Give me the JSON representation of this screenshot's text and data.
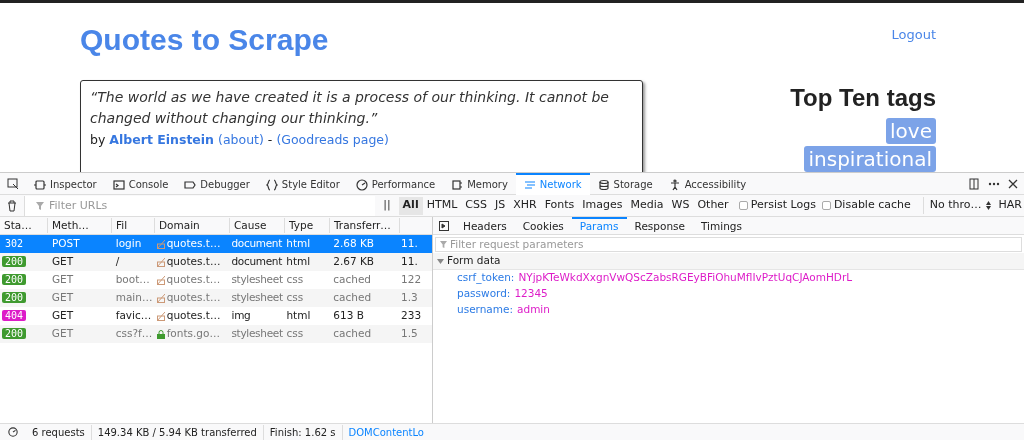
{
  "page": {
    "title": "Quotes to Scrape",
    "logout": "Logout",
    "quote": {
      "text": "“The world as we have created it is a process of our thinking. It cannot be changed without changing our thinking.”",
      "by": "by",
      "author": "Albert Einstein",
      "about": "(about)",
      "dash": "-",
      "goodreads": "(Goodreads page)"
    },
    "tags_heading": "Top Ten tags",
    "tags": [
      "love",
      "inspirational"
    ]
  },
  "devtools": {
    "tabs": [
      {
        "label": "Inspector",
        "selected": false
      },
      {
        "label": "Console",
        "selected": false
      },
      {
        "label": "Debugger",
        "selected": false
      },
      {
        "label": "Style Editor",
        "selected": false
      },
      {
        "label": "Performance",
        "selected": false
      },
      {
        "label": "Memory",
        "selected": false
      },
      {
        "label": "Network",
        "selected": true
      },
      {
        "label": "Storage",
        "selected": false
      },
      {
        "label": "Accessibility",
        "selected": false
      }
    ],
    "filter_placeholder": "Filter URLs",
    "pause": "||",
    "type_filters": [
      {
        "label": "All",
        "selected": true
      },
      {
        "label": "HTML",
        "selected": false
      },
      {
        "label": "CSS",
        "selected": false
      },
      {
        "label": "JS",
        "selected": false
      },
      {
        "label": "XHR",
        "selected": false
      },
      {
        "label": "Fonts",
        "selected": false
      },
      {
        "label": "Images",
        "selected": false
      },
      {
        "label": "Media",
        "selected": false
      },
      {
        "label": "WS",
        "selected": false
      },
      {
        "label": "Other",
        "selected": false
      }
    ],
    "options": [
      {
        "label": "Persist Logs",
        "checked": false
      },
      {
        "label": "Disable cache",
        "checked": false
      }
    ],
    "throttle": "No thro…",
    "har": "HAR",
    "columns": [
      "Sta…",
      "Meth…",
      "Fil",
      "Domain",
      "Cause",
      "Type",
      "Transferr…"
    ],
    "rows": [
      {
        "status": "302",
        "method": "POST",
        "file": "login",
        "domain": "quotes.t…",
        "secure": false,
        "cause": "document",
        "type": "html",
        "transferred": "2.68 KB",
        "size": "11.",
        "dimmed": false,
        "selected": true
      },
      {
        "status": "200",
        "color": "#3f9a2f",
        "method": "GET",
        "file": "/",
        "domain": "quotes.t…",
        "secure": false,
        "cause": "document",
        "type": "html",
        "transferred": "2.67 KB",
        "size": "11.",
        "dimmed": false,
        "selected": false
      },
      {
        "status": "200",
        "color": "#3f9a2f",
        "method": "GET",
        "file": "boot…",
        "domain": "quotes.t…",
        "secure": false,
        "cause": "stylesheet",
        "type": "css",
        "transferred": "cached",
        "size": "122",
        "dimmed": true,
        "selected": false
      },
      {
        "status": "200",
        "color": "#3f9a2f",
        "method": "GET",
        "file": "main…",
        "domain": "quotes.t…",
        "secure": false,
        "cause": "stylesheet",
        "type": "css",
        "transferred": "cached",
        "size": "1.3",
        "dimmed": true,
        "selected": false
      },
      {
        "status": "404",
        "color": "#dd1cc8",
        "method": "GET",
        "file": "favic…",
        "domain": "quotes.t…",
        "secure": false,
        "cause": "img",
        "type": "html",
        "transferred": "613 B",
        "size": "233",
        "dimmed": false,
        "selected": false
      },
      {
        "status": "200",
        "color": "#3f9a2f",
        "method": "GET",
        "file": "css?f…",
        "domain": "fonts.go…",
        "secure": true,
        "cause": "stylesheet",
        "type": "css",
        "transferred": "cached",
        "size": "1.5",
        "dimmed": true,
        "selected": false
      }
    ],
    "detail_tabs": [
      {
        "label": "Headers",
        "selected": false
      },
      {
        "label": "Cookies",
        "selected": false
      },
      {
        "label": "Params",
        "selected": true
      },
      {
        "label": "Response",
        "selected": false
      },
      {
        "label": "Timings",
        "selected": false
      }
    ],
    "params_placeholder": "Filter request parameters",
    "form_data": {
      "title": "Form data",
      "expanded": true,
      "params": [
        {
          "name": "csrf_token:",
          "value": "NYjpKTeWkdXxgnVwQScZabsRGEyBFiOhuMflIvPztUqCJAomHDrL"
        },
        {
          "name": "password:",
          "value": "12345"
        },
        {
          "name": "username:",
          "value": "admin"
        }
      ]
    },
    "status_bar": {
      "requests": "6 requests",
      "size": "149.34 KB / 5.94 KB transferred",
      "finish": "Finish: 1.62 s",
      "dom": "DOMContentLo"
    }
  }
}
